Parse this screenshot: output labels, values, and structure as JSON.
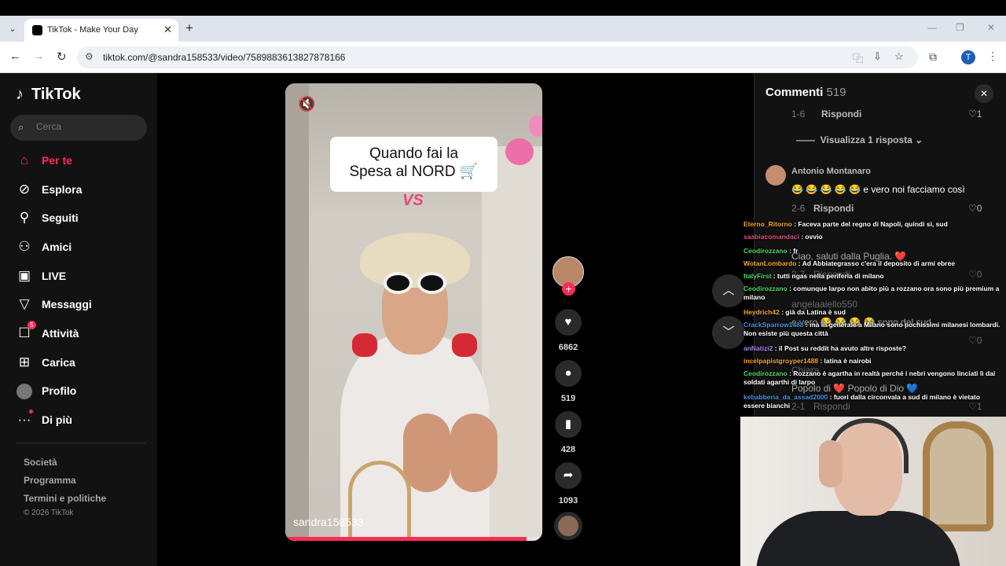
{
  "browser": {
    "tab_title": "TikTok - Make Your Day",
    "tab_close": "✕",
    "new_tab": "+",
    "url": "tiktok.com/@sandra158533/video/7589883613827878166",
    "profile_initial": "T"
  },
  "sidebar": {
    "logo": "TikTok",
    "search_placeholder": "Cerca",
    "items": [
      {
        "label": "Per te",
        "icon": "home-icon",
        "active": true
      },
      {
        "label": "Esplora",
        "icon": "compass-icon"
      },
      {
        "label": "Seguiti",
        "icon": "user-follow-icon"
      },
      {
        "label": "Amici",
        "icon": "friends-icon"
      },
      {
        "label": "LIVE",
        "icon": "live-icon"
      },
      {
        "label": "Messaggi",
        "icon": "send-icon"
      },
      {
        "label": "Attività",
        "icon": "inbox-icon",
        "badge": "5"
      },
      {
        "label": "Carica",
        "icon": "upload-icon"
      },
      {
        "label": "Profilo",
        "icon": "avatar-icon"
      },
      {
        "label": "Di più",
        "icon": "more-icon"
      }
    ],
    "footer": [
      "Società",
      "Programma",
      "Termini e politiche"
    ],
    "copyright": "© 2026 TikTok"
  },
  "video": {
    "caption_line1": "Quando fai la",
    "caption_line2": "Spesa al NORD 🛒",
    "vs": "VS",
    "author": "sandra158533",
    "progress": 0.94
  },
  "actions": {
    "likes": "6862",
    "comments": "519",
    "saves": "428",
    "shares": "1093"
  },
  "comments": {
    "title": "Commenti",
    "count": "519",
    "reply_count_meta": "1-6",
    "reply_label": "Rispondi",
    "reply_likes": "1",
    "view_replies": "Visualizza 1 risposta",
    "commenter": "Antonio Montanaro",
    "comment_text": "😂 😂 😂 😂 😂 e vero noi facciamo così",
    "comment_meta": "2-6",
    "comment_reply": "Rispondi",
    "comment_likes": "0",
    "ghost_text_1": "Ciao, saluti dalla Puglia. ❤️",
    "ghost_meta_1": "2-7",
    "ghost_reply_1": "Rispondi",
    "ghost_likes_1": "0",
    "ghost_name_2": "angelaaiello550",
    "ghost_text_2": "e vero 😂 😂 😂 😂 sono del sud",
    "ghost_likes_2": "0",
    "ghost_name_3": "Chiara",
    "ghost_text_3": "Popolo di ❤️ Popolo di Dio 💙",
    "ghost_meta_3": "2-1",
    "ghost_reply_3": "Rispondi",
    "ghost_likes_3": "1"
  },
  "chat": [
    {
      "user": "Eterno_Ritorno",
      "color": "#f5a623",
      "text": ": Faceva parte del regno di Napoli, quindi sì, sud"
    },
    {
      "user": "saabiacomandaci",
      "color": "#e04f7c",
      "text": ": ovvio"
    },
    {
      "user": "Ceodirozzano",
      "color": "#4cd964",
      "text": ": fr"
    },
    {
      "user": "WotanLombardo",
      "color": "#f5a623",
      "text": ": Ad Abbiategrasso c'era il deposito di armi ebree"
    },
    {
      "user": "ItalyFirst",
      "color": "#4cd964",
      "text": ": tutti ngas nella periferia di milano"
    },
    {
      "user": "Ceodirozzano",
      "color": "#4cd964",
      "text": ": comunque Iarpo non abito più a rozzano ora sono più premium a milano"
    },
    {
      "user": "Heydrich42",
      "color": "#f5a623",
      "text": ": già da Latina è sud"
    },
    {
      "user": "CrackSparrow1488",
      "color": "#4a90e2",
      "text": ": ma in generale a Milano sono pochissimi milanesi lombardi. Non esiste più questa città"
    },
    {
      "user": "anNatizi2",
      "color": "#b07cf0",
      "text": ": il Post su reddit ha avuto altre risposte?"
    },
    {
      "user": "incelpapistgroyper1488",
      "color": "#f5a623",
      "text": ": latina è nairobi"
    },
    {
      "user": "Ceodirozzano",
      "color": "#4cd964",
      "text": ": Rozzano è agartha in realtà perché i nebri vengono linciati lì dai soldati agarthi di Iarpo"
    },
    {
      "user": "kebabberia_da_assad2000",
      "color": "#4a90e2",
      "text": ": fuori dalla circonvala a sud di milano è vietato essere bianchi"
    }
  ]
}
